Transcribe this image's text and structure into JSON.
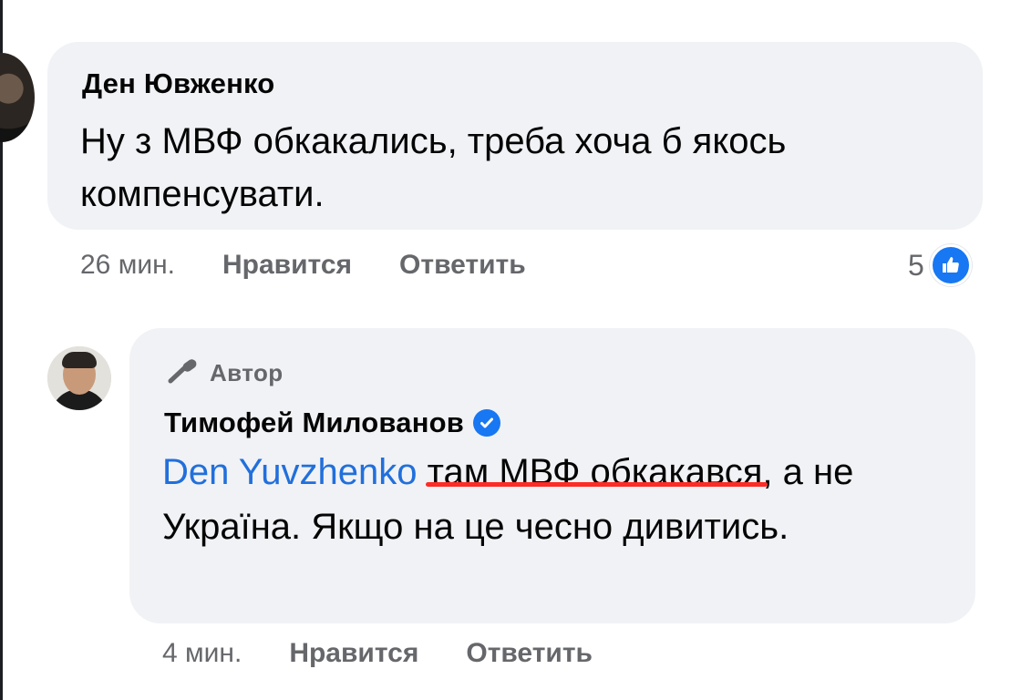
{
  "comments": [
    {
      "author": "Ден Ювженко",
      "text": "Ну з МВФ обкакались, треба хоча б якось компенсувати.",
      "time": "26 мин.",
      "like_label": "Нравится",
      "reply_label": "Ответить",
      "reaction_count": "5",
      "reaction_icon": "like-icon"
    },
    {
      "badge_icon": "microphone-icon",
      "badge_label": "Автор",
      "author": "Тимофей Милованов",
      "verified_icon": "verified-badge-icon",
      "mention": "Den Yuvzhenko",
      "text_highlighted": "там МВФ обкакався,",
      "text_rest_line1": " а",
      "text_rest": "не Україна. Якщо на це чесно дивитись.",
      "time": "4 мин.",
      "like_label": "Нравится",
      "reply_label": "Ответить"
    }
  ],
  "colors": {
    "bubble": "#f0f2f5",
    "mention": "#216fdb",
    "underline": "#ff2b25",
    "meta": "#65676b",
    "like_blue": "#1877f2"
  }
}
